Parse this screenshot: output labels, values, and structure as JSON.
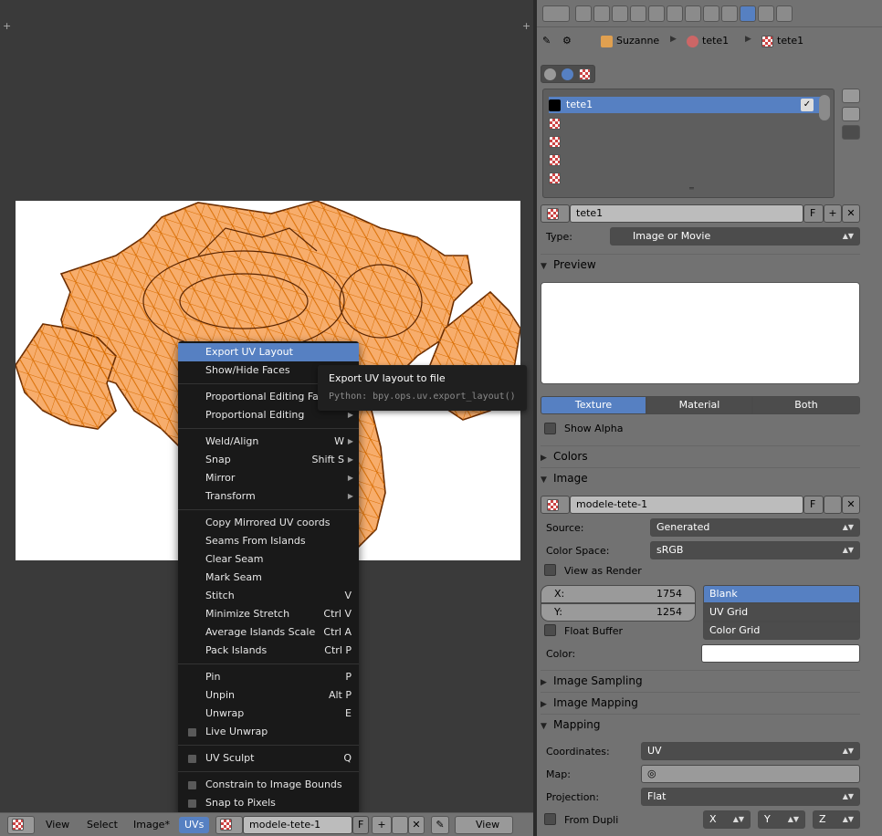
{
  "uv_menu": {
    "items": [
      {
        "label": "Export UV Layout",
        "shortcut": "",
        "submenu": false,
        "checkbox": false,
        "active": true
      },
      {
        "label": "Show/Hide Faces",
        "shortcut": "",
        "submenu": false,
        "checkbox": false
      },
      {
        "sep": true
      },
      {
        "label": "Proportional Editing Falloff",
        "shortcut": "",
        "submenu": true,
        "checkbox": false
      },
      {
        "label": "Proportional Editing",
        "shortcut": "",
        "submenu": true,
        "checkbox": false
      },
      {
        "sep": true
      },
      {
        "label": "Weld/Align",
        "shortcut": "W",
        "submenu": true,
        "checkbox": false
      },
      {
        "label": "Snap",
        "shortcut": "Shift S",
        "submenu": true,
        "checkbox": false
      },
      {
        "label": "Mirror",
        "shortcut": "",
        "submenu": true,
        "checkbox": false
      },
      {
        "label": "Transform",
        "shortcut": "",
        "submenu": true,
        "checkbox": false
      },
      {
        "sep": true
      },
      {
        "label": "Copy Mirrored UV coords",
        "shortcut": "",
        "submenu": false,
        "checkbox": false
      },
      {
        "label": "Seams From Islands",
        "shortcut": "",
        "submenu": false,
        "checkbox": false
      },
      {
        "label": "Clear Seam",
        "shortcut": "",
        "submenu": false,
        "checkbox": false
      },
      {
        "label": "Mark Seam",
        "shortcut": "",
        "submenu": false,
        "checkbox": false
      },
      {
        "label": "Stitch",
        "shortcut": "V",
        "submenu": false,
        "checkbox": false
      },
      {
        "label": "Minimize Stretch",
        "shortcut": "Ctrl V",
        "submenu": false,
        "checkbox": false
      },
      {
        "label": "Average Islands Scale",
        "shortcut": "Ctrl A",
        "submenu": false,
        "checkbox": false
      },
      {
        "label": "Pack Islands",
        "shortcut": "Ctrl P",
        "submenu": false,
        "checkbox": false
      },
      {
        "sep": true
      },
      {
        "label": "Pin",
        "shortcut": "P",
        "submenu": false,
        "checkbox": false
      },
      {
        "label": "Unpin",
        "shortcut": "Alt P",
        "submenu": false,
        "checkbox": false
      },
      {
        "label": "Unwrap",
        "shortcut": "E",
        "submenu": false,
        "checkbox": false
      },
      {
        "label": "Live Unwrap",
        "shortcut": "",
        "submenu": false,
        "checkbox": true
      },
      {
        "sep": true
      },
      {
        "label": "UV Sculpt",
        "shortcut": "Q",
        "submenu": false,
        "checkbox": true
      },
      {
        "sep": true
      },
      {
        "label": "Constrain to Image Bounds",
        "shortcut": "",
        "submenu": false,
        "checkbox": true
      },
      {
        "label": "Snap to Pixels",
        "shortcut": "",
        "submenu": false,
        "checkbox": true
      }
    ]
  },
  "tooltip": {
    "title": "Export UV layout to file",
    "python": "Python: bpy.ops.uv.export_layout()"
  },
  "bottom_bar": {
    "view": "View",
    "select": "Select",
    "image": "Image*",
    "uvs": "UVs",
    "image_name": "modele-tete-1",
    "fake_user": "F",
    "view2": "View"
  },
  "props": {
    "crumbs": [
      "Suzanne",
      "tete1",
      "tete1"
    ],
    "tex_list": [
      {
        "name": "tete1"
      },
      {
        "name": ""
      },
      {
        "name": ""
      },
      {
        "name": ""
      },
      {
        "name": ""
      }
    ],
    "tex_name": "tete1",
    "fake_user": "F",
    "type_label": "Type:",
    "type_value": "Image or Movie",
    "preview_title": "Preview",
    "seg": [
      "Texture",
      "Material",
      "Both"
    ],
    "show_alpha": "Show Alpha",
    "colors_title": "Colors",
    "image_title": "Image",
    "image_name": "modele-tete-1",
    "source_label": "Source:",
    "source_value": "Generated",
    "colorspace_label": "Color Space:",
    "colorspace_value": "sRGB",
    "view_as_render": "View as Render",
    "x_label": "X:",
    "x_value": "1754",
    "y_label": "Y:",
    "y_value": "1254",
    "gen_types": [
      "Blank",
      "UV Grid",
      "Color Grid"
    ],
    "float_buffer": "Float Buffer",
    "color_label": "Color:",
    "sampling_title": "Image Sampling",
    "mapping_img_title": "Image Mapping",
    "mapping_title": "Mapping",
    "coords_label": "Coordinates:",
    "coords_value": "UV",
    "map_label": "Map:",
    "projection_label": "Projection:",
    "projection_value": "Flat",
    "from_dupli": "From Dupli",
    "axes": [
      "X",
      "Y",
      "Z"
    ]
  },
  "colors": {
    "accent": "#5680c2",
    "mesh_fill": "#f7ad6c",
    "mesh_edge": "#ff8a00"
  }
}
